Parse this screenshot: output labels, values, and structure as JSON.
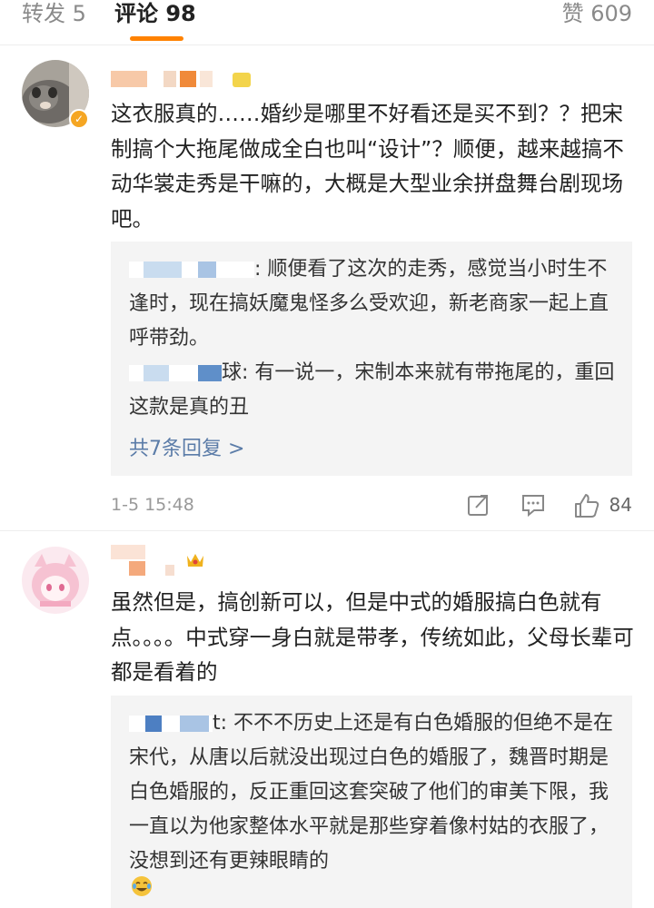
{
  "tabs": {
    "repost": "转发 5",
    "comments": "评论 98",
    "likes": "赞 609"
  },
  "comments": [
    {
      "text": "这衣服真的……婚纱是哪里不好看还是买不到？？把宋制搞个大拖尾做成全白也叫“设计”？顺便，越来越搞不动华裳走秀是干嘛的，大概是大型业余拼盘舞台剧现场吧。",
      "replies": [
        {
          "text": ": 顺便看了这次的走秀，感觉当小时生不逢时，现在搞妖魔鬼怪多么受欢迎，新老商家一起上直呼带劲。"
        },
        {
          "text": "球: 有一说一，宋制本来就有带拖尾的，重回这款是真的丑"
        }
      ],
      "more_replies": "共7条回复 >",
      "time": "1-5 15:48",
      "like_count": "84"
    },
    {
      "text": "虽然但是，搞创新可以，但是中式的婚服搞白色就有点。。。。中式穿一身白就是带孝，传统如此，父母长辈可都是看着的",
      "replies": [
        {
          "text": "t: 不不不历史上还是有白色婚服的但绝不是在宋代，从唐以后就没出现过白色的婚服了，魏晋时期是白色婚服的，反正重回这套突破了他们的审美下限，我一直以为他家整体水平就是那些穿着像村姑的衣服了，没想到还有更辣眼睛的"
        }
      ]
    }
  ],
  "colors": {
    "accent": "#ff8200",
    "link": "#5b7ca8",
    "reply_bg": "#f4f4f4"
  }
}
